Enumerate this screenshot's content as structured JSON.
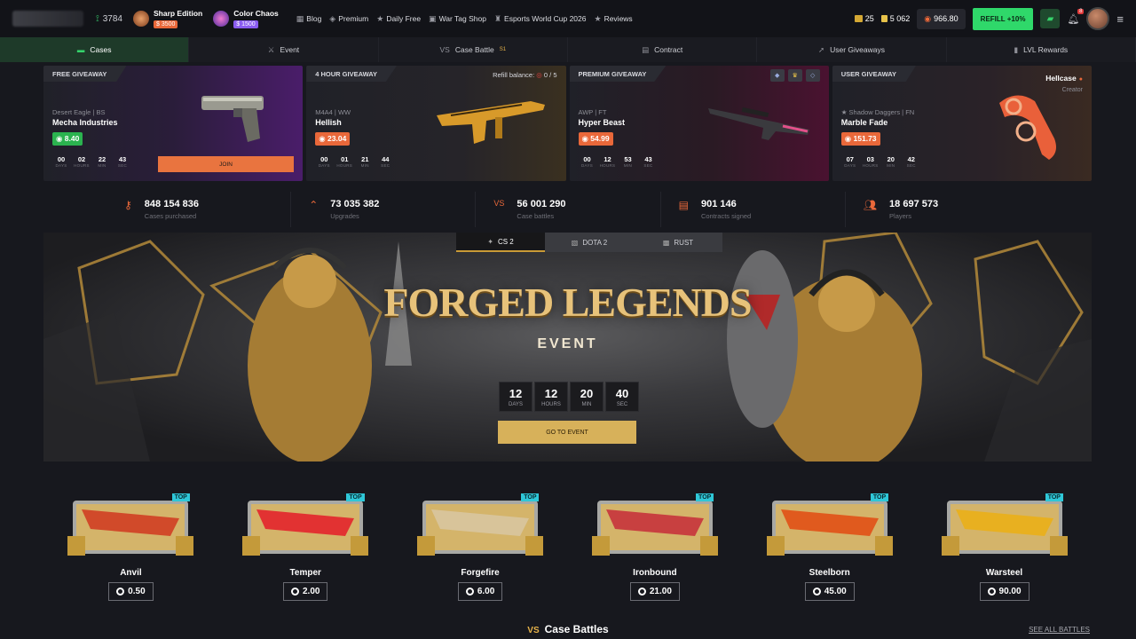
{
  "header": {
    "online_count": "3784",
    "promos": [
      {
        "title": "Sharp Edition",
        "price": "$ 3500",
        "color": "#e9683a"
      },
      {
        "title": "Color Chaos",
        "price": "$ 1500",
        "color": "#8a5cf0"
      }
    ],
    "nav": [
      {
        "label": "Blog",
        "icon": "grid-icon"
      },
      {
        "label": "Premium",
        "icon": "diamond-icon"
      },
      {
        "label": "Daily Free",
        "icon": "star-icon"
      },
      {
        "label": "War Tag Shop",
        "icon": "tag-icon"
      },
      {
        "label": "Esports World Cup 2026",
        "icon": "trophy-icon"
      },
      {
        "label": "Reviews",
        "icon": "star-icon"
      }
    ],
    "gold_amount": "25",
    "coins_amount": "5 062",
    "balance": "966.80",
    "refill_label": "REFILL +10%",
    "notif_count": "8"
  },
  "tabs": [
    {
      "label": "Cases",
      "icon": "box-icon",
      "active": true
    },
    {
      "label": "Event",
      "icon": "sword-icon",
      "active": false
    },
    {
      "label": "Case Battle",
      "icon": "versus-icon",
      "active": false,
      "badge": "S1"
    },
    {
      "label": "Contract",
      "icon": "document-icon",
      "active": false
    },
    {
      "label": "User Giveaways",
      "icon": "cursor-icon",
      "active": false
    },
    {
      "label": "LVL Rewards",
      "icon": "bar-chart-icon",
      "active": false
    }
  ],
  "giveaways": [
    {
      "header": "FREE GIVEAWAY",
      "sub": "Desert Eagle | BS",
      "name": "Mecha Industries",
      "price": "8.40",
      "price_style": "green",
      "timer": [
        "00",
        "02",
        "22",
        "43"
      ],
      "join": "JOIN"
    },
    {
      "header": "4 HOUR GIVEAWAY",
      "sub": "M4A4 | WW",
      "name": "Hellish",
      "price": "23.04",
      "price_style": "orange",
      "timer": [
        "00",
        "01",
        "21",
        "44"
      ],
      "refill_label": "Refill balance:",
      "refill_value": "0 / 5"
    },
    {
      "header": "PREMIUM GIVEAWAY",
      "sub": "AWP | FT",
      "name": "Hyper Beast",
      "price": "54.99",
      "price_style": "orange",
      "timer": [
        "00",
        "12",
        "53",
        "43"
      ]
    },
    {
      "header": "USER GIVEAWAY",
      "sub": "★ Shadow Daggers | FN",
      "name": "Marble Fade",
      "price": "151.73",
      "price_style": "orange",
      "timer": [
        "07",
        "03",
        "20",
        "42"
      ],
      "creator": "Hellcase",
      "creator_label": "Creator"
    }
  ],
  "timer_units": [
    "DAYS",
    "HOURS",
    "MIN",
    "SEC"
  ],
  "stats": [
    {
      "value": "848 154 836",
      "label": "Cases purchased",
      "icon": "key-icon"
    },
    {
      "value": "73 035 382",
      "label": "Upgrades",
      "icon": "upgrade-icon"
    },
    {
      "value": "56 001 290",
      "label": "Case battles",
      "icon": "versus-icon"
    },
    {
      "value": "901 146",
      "label": "Contracts signed",
      "icon": "document-icon"
    },
    {
      "value": "18 697 573",
      "label": "Players",
      "icon": "users-icon"
    }
  ],
  "banner": {
    "games": [
      {
        "label": "CS 2",
        "active": true
      },
      {
        "label": "DOTA 2",
        "active": false
      },
      {
        "label": "RUST",
        "active": false
      }
    ],
    "title": "FORGED LEGENDS",
    "subtitle": "EVENT",
    "countdown": [
      {
        "value": "12",
        "unit": "DAYS"
      },
      {
        "value": "12",
        "unit": "HOURS"
      },
      {
        "value": "20",
        "unit": "MIN"
      },
      {
        "value": "40",
        "unit": "SEC"
      }
    ],
    "cta": "GO TO EVENT"
  },
  "cases": [
    {
      "name": "Anvil",
      "price": "0.50",
      "badge": "TOP",
      "accent": "#d14a2a"
    },
    {
      "name": "Temper",
      "price": "2.00",
      "badge": "TOP",
      "accent": "#e23232"
    },
    {
      "name": "Forgefire",
      "price": "6.00",
      "badge": "TOP",
      "accent": "#d8c49a"
    },
    {
      "name": "Ironbound",
      "price": "21.00",
      "badge": "TOP",
      "accent": "#c84040"
    },
    {
      "name": "Steelborn",
      "price": "45.00",
      "badge": "TOP",
      "accent": "#e05a1e"
    },
    {
      "name": "Warsteel",
      "price": "90.00",
      "badge": "TOP",
      "accent": "#e8b020"
    }
  ],
  "battles": {
    "title": "Case Battles",
    "see_all": "SEE ALL BATTLES"
  }
}
